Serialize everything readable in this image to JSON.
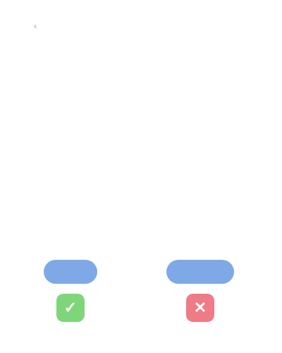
{
  "nav": {
    "back_label": "‹"
  },
  "main": {
    "headline": "",
    "paragraphs": [
      "",
      ""
    ]
  },
  "actions": {
    "left": {
      "button_label": "",
      "badge_icon": "check-icon",
      "badge_glyph": "✓",
      "button_color": "#7ea9e6",
      "badge_color": "#7fd67a"
    },
    "right": {
      "button_label": "",
      "badge_icon": "cross-icon",
      "badge_glyph": "✕",
      "button_color": "#7ea9e6",
      "badge_color": "#ee7b85"
    }
  }
}
